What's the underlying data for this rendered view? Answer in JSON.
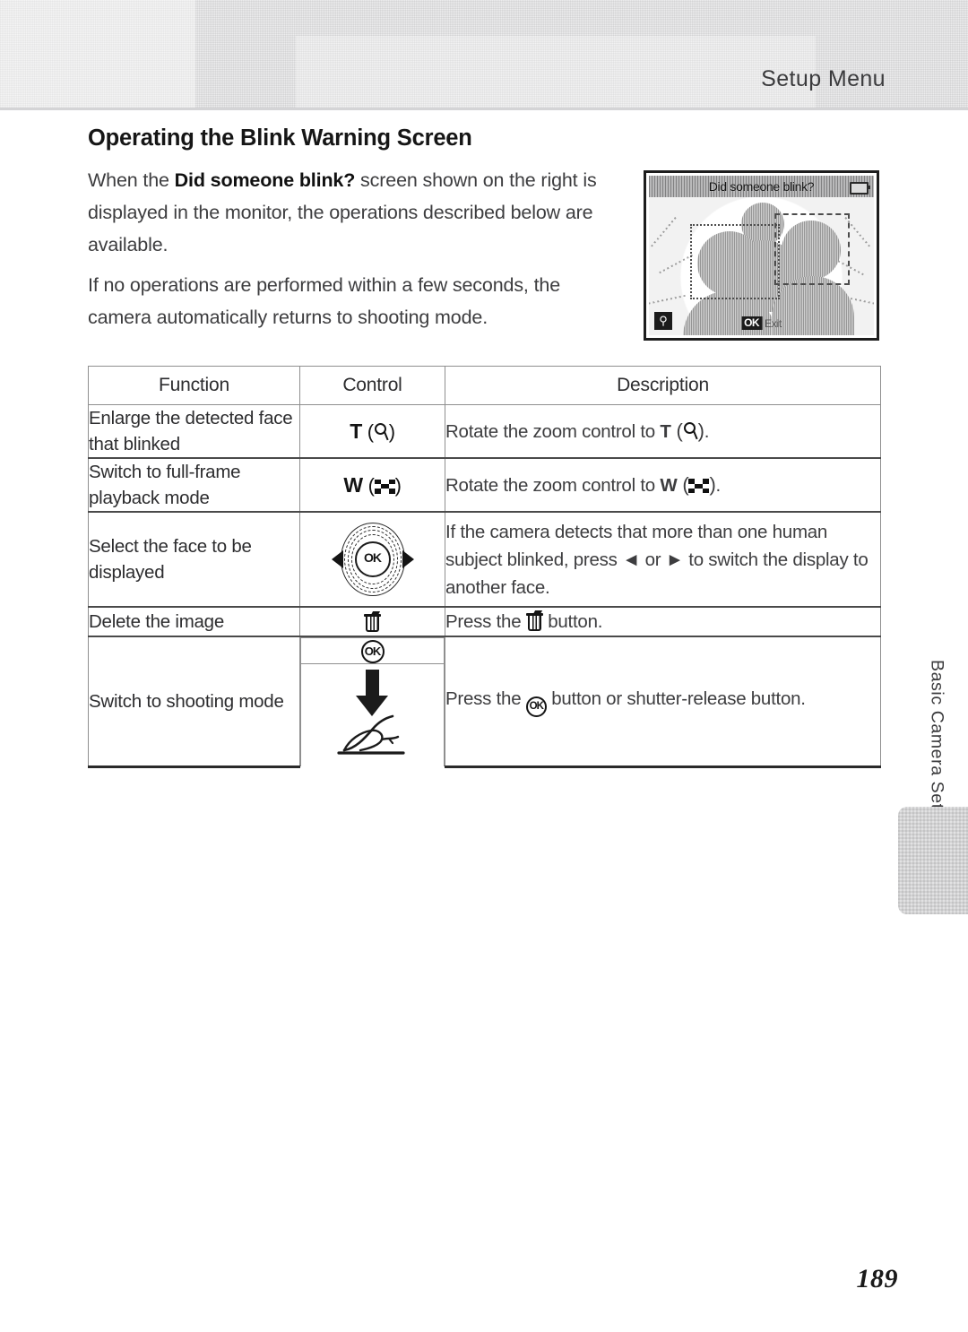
{
  "header": {
    "title": "Setup Menu"
  },
  "section": {
    "title": "Operating the Blink Warning Screen",
    "paragraph1_pre": "When the ",
    "paragraph1_bold": "Did someone blink?",
    "paragraph1_post": " screen shown on the right is displayed in the monitor, the operations described below are available.",
    "paragraph2": "If no operations are performed within a few seconds, the camera automatically returns to shooting mode."
  },
  "monitor": {
    "title": "Did someone blink?",
    "ok_label": "OK",
    "exit_label": "Exit",
    "zoom_icon": "magnifier-icon",
    "battery_icon": "battery-icon"
  },
  "table": {
    "headers": {
      "function": "Function",
      "control": "Control",
      "description": "Description"
    },
    "rows": [
      {
        "function": "Enlarge the detected face that blinked",
        "control_text": "T",
        "control_icon": "magnifier-icon",
        "description_pre": "Rotate the zoom control to ",
        "description_bold": "T",
        "description_icon": "magnifier-icon",
        "description_post": "."
      },
      {
        "function": "Switch to full-frame playback mode",
        "control_text": "W",
        "control_icon": "thumbnail-icon",
        "description_pre": "Rotate the zoom control to ",
        "description_bold": "W",
        "description_icon": "thumbnail-icon",
        "description_post": "."
      },
      {
        "function": "Select the face to be displayed",
        "control_text": "OK",
        "control_icon": "multi-selector-icon",
        "description_pre": "If the camera detects that more than one human subject blinked, press ",
        "description_icon_left": "left-arrow-icon",
        "description_mid": " or ",
        "description_icon_right": "right-arrow-icon",
        "description_post": " to switch the display to another face."
      },
      {
        "function": "Delete the image",
        "control_icon": "trash-icon",
        "description_pre": "Press the ",
        "description_icon": "trash-icon",
        "description_post": " button."
      },
      {
        "function": "Switch to shooting mode",
        "control_icon_top": "ok-button-icon",
        "control_icon_bottom": "shutter-press-icon",
        "description_pre": "Press the ",
        "description_icon": "ok-button-icon",
        "description_post": " button or shutter-release button."
      }
    ]
  },
  "side_tab": {
    "label": "Basic Camera Setup"
  },
  "page_number": "189"
}
